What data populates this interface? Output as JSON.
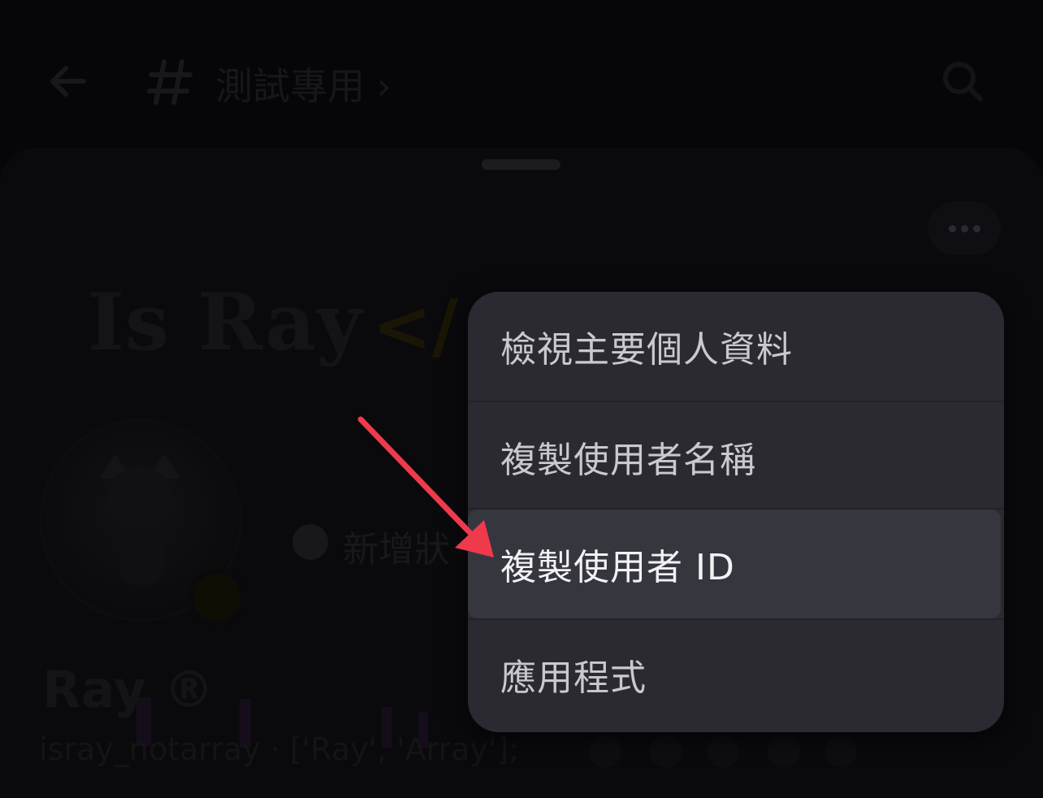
{
  "header": {
    "channel_title": "測試專用 ›"
  },
  "profile": {
    "banner_name": "Is Ray",
    "banner_code": "</",
    "add_status_label": "新增狀",
    "display_name": "Ray ®",
    "bio": "isray_notarray · ['Ray', 'Array'];"
  },
  "context_menu": {
    "items": [
      {
        "label": "檢視主要個人資料"
      },
      {
        "label": "複製使用者名稱"
      },
      {
        "label": "複製使用者 ID"
      },
      {
        "label": "應用程式"
      }
    ]
  },
  "colors": {
    "menu_background": "#2a2a30",
    "menu_highlight": "#36363f",
    "arrow": "#ef3a4c"
  },
  "icons": [
    "back-arrow-icon",
    "thread-icon",
    "search-icon",
    "more-icon",
    "plus-icon"
  ]
}
